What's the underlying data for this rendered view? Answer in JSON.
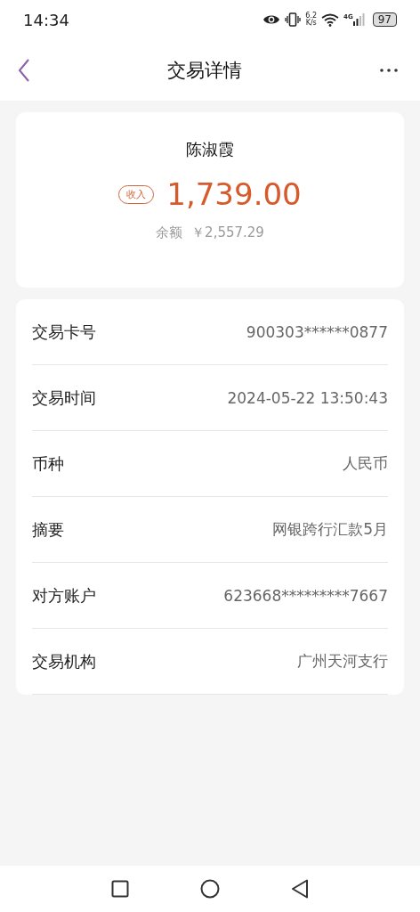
{
  "status_bar": {
    "time": "14:34",
    "net_speed": [
      "6.2",
      "K/s"
    ],
    "network": "4G",
    "battery": "97"
  },
  "header": {
    "title": "交易详情"
  },
  "summary": {
    "name": "陈淑霞",
    "type_badge": "收入",
    "amount": "1,739.00",
    "balance_label": "余额",
    "balance": "￥2,557.29"
  },
  "details": [
    {
      "label": "交易卡号",
      "value": "900303******0877"
    },
    {
      "label": "交易时间",
      "value": "2024-05-22 13:50:43"
    },
    {
      "label": "币种",
      "value": "人民币"
    },
    {
      "label": "摘要",
      "value": "网银跨行汇款5月"
    },
    {
      "label": "对方账户",
      "value": "623668*********7667"
    },
    {
      "label": "交易机构",
      "value": "广州天河支行"
    }
  ]
}
